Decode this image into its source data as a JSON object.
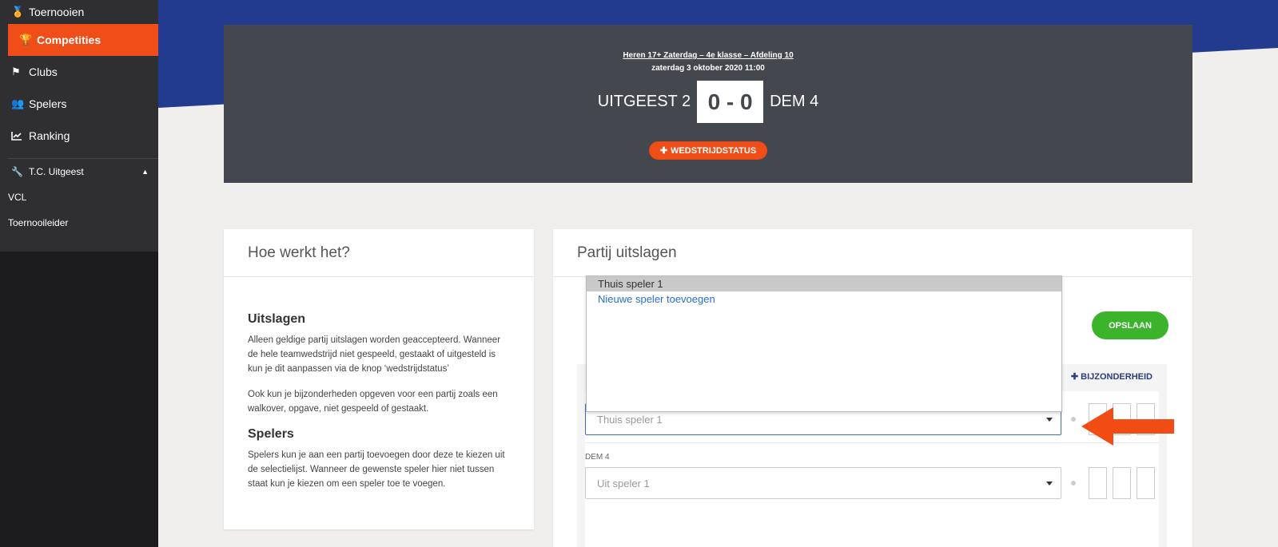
{
  "sidebar": {
    "items": [
      {
        "label": "Toernooien",
        "icon": "medal-icon",
        "glyph": "🏅"
      },
      {
        "label": "Competities",
        "icon": "trophy-icon",
        "glyph": "🏆"
      },
      {
        "label": "Clubs",
        "icon": "flag-icon",
        "glyph": "⚑"
      },
      {
        "label": "Spelers",
        "icon": "users-icon",
        "glyph": "👥"
      },
      {
        "label": "Ranking",
        "icon": "chart-line-icon",
        "glyph": "📈"
      }
    ],
    "club": {
      "label": "T.C. Uitgeest",
      "icon": "wrench-icon"
    },
    "links": [
      "VCL",
      "Toernooileider"
    ]
  },
  "match": {
    "competition": "Heren 17+ Zaterdag – 4e klasse – Afdeling 10",
    "date": "zaterdag 3 oktober 2020 11:00",
    "home_team": "UITGEEST 2",
    "score": "0 - 0",
    "away_team": "DEM 4",
    "status_button": "WEDSTRIJDSTATUS",
    "status_icon": "plus-icon"
  },
  "help": {
    "title": "Hoe werkt het?",
    "sections": [
      {
        "heading": "Uitslagen",
        "paragraphs": [
          "Alleen geldige partij uitslagen worden geaccepteerd. Wanneer de hele teamwedstrijd niet gespeeld, gestaakt of uitgesteld is kun je dit aanpassen via de knop ‘wedstrijdstatus’",
          "Ook kun je bijzonderheden opgeven voor een partij zoals een walkover, opgave, niet gespeeld of gestaakt."
        ]
      },
      {
        "heading": "Spelers",
        "paragraphs": [
          "Spelers kun je aan een partij toevoegen door deze te kiezen uit de selectielijst. Wanneer de gewenste speler hier niet tussen staat kun je kiezen om een speler toe te voegen."
        ]
      }
    ]
  },
  "results": {
    "title": "Partij uitslagen",
    "save_label": "OPSLAAN",
    "bijzonderheid_label": "BIJZONDERHEID",
    "home_select": {
      "value": "Thuis speler 1"
    },
    "away_label": "DEM 4",
    "away_select": {
      "value": "Uit speler 1"
    },
    "dropdown_options": [
      "Thuis speler 1",
      "Nieuwe speler toevoegen"
    ]
  },
  "colors": {
    "accent_orange": "#ef4e18",
    "banner_blue": "#233b8f",
    "save_green": "#3bb42c",
    "card_dark": "#45474f",
    "annotation_arrow": "#f04c14"
  }
}
